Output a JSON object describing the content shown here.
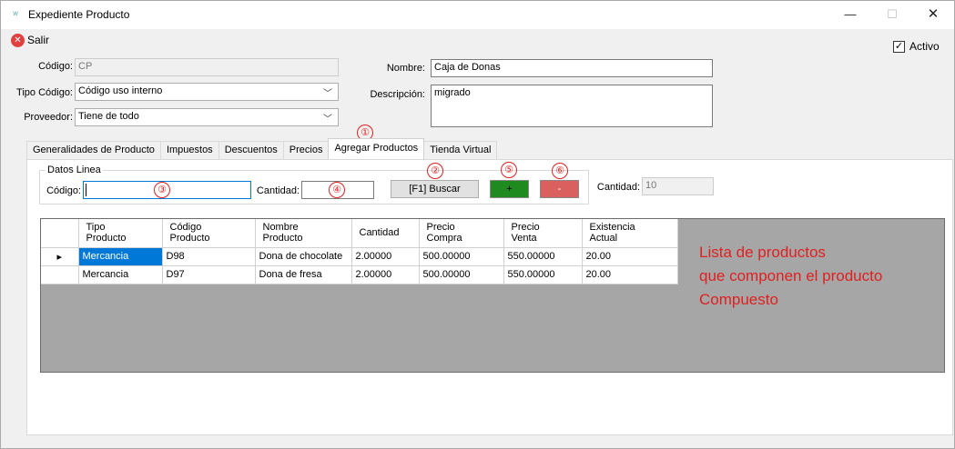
{
  "window": {
    "title": "Expediente Producto",
    "minimize": "—",
    "maximize": "☐",
    "close": "✕"
  },
  "toolbar": {
    "salir_label": "Salir"
  },
  "activo": {
    "label": "Activo",
    "checked": true
  },
  "form": {
    "codigo_label": "Código:",
    "codigo_value": "CP",
    "tipo_codigo_label": "Tipo Código:",
    "tipo_codigo_value": "Código uso interno",
    "proveedor_label": "Proveedor:",
    "proveedor_value": "Tiene de todo",
    "nombre_label": "Nombre:",
    "nombre_value": "Caja de Donas",
    "descripcion_label": "Descripción:",
    "descripcion_value": "migrado"
  },
  "tabs": [
    {
      "label": "Generalidades de Producto",
      "active": false
    },
    {
      "label": "Impuestos",
      "active": false
    },
    {
      "label": "Descuentos",
      "active": false
    },
    {
      "label": "Precios",
      "active": false
    },
    {
      "label": "Agregar Productos",
      "active": true
    },
    {
      "label": "Tienda Virtual",
      "active": false
    }
  ],
  "datos_linea": {
    "title": "Datos Linea",
    "codigo_label": "Código:",
    "codigo_value": "",
    "cantidad_label": "Cantidad:",
    "cantidad_value": "",
    "buscar_label": "[F1] Buscar",
    "plus_label": "+",
    "minus_label": "-",
    "cantidad_total_label": "Cantidad:",
    "cantidad_total_value": "10"
  },
  "annotations": [
    "①",
    "②",
    "③",
    "④",
    "⑤",
    "⑥"
  ],
  "grid": {
    "headers": [
      "Tipo\nProducto",
      "Código\nProducto",
      "Nombre\nProducto",
      "Cantidad",
      "Precio\nCompra",
      "Precio\nVenta",
      "Existencia\nActual"
    ],
    "rows": [
      {
        "current": true,
        "cells": [
          "Mercancia",
          "D98",
          "Dona de chocolate",
          "2.00000",
          "500.00000",
          "550.00000",
          "20.00"
        ]
      },
      {
        "current": false,
        "cells": [
          "Mercancia",
          "D97",
          "Dona de fresa",
          "2.00000",
          "500.00000",
          "550.00000",
          "20.00"
        ]
      }
    ]
  },
  "note": {
    "line1": "Lista de productos",
    "line2": "que componen el producto",
    "line3": "Compuesto"
  },
  "colors": {
    "accent": "#0078d7",
    "annotation_red": "#e02020",
    "plus_green": "#1f8a1f",
    "minus_red": "#d9605e"
  }
}
